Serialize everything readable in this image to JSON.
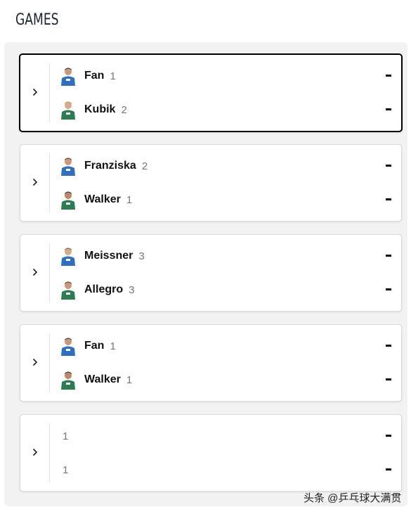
{
  "section_title": "GAMES",
  "colors": {
    "team_a": "#2f6fc2",
    "team_b": "#2d7d52",
    "selected_border": "#000000"
  },
  "games": [
    {
      "selected": true,
      "player1": {
        "name": "Fan",
        "games": "1",
        "team": "blue"
      },
      "player2": {
        "name": "Kubik",
        "games": "2",
        "team": "green"
      },
      "score1": "-",
      "score2": "-"
    },
    {
      "selected": false,
      "player1": {
        "name": "Franziska",
        "games": "2",
        "team": "blue"
      },
      "player2": {
        "name": "Walker",
        "games": "1",
        "team": "green"
      },
      "score1": "-",
      "score2": "-"
    },
    {
      "selected": false,
      "player1": {
        "name": "Meissner",
        "games": "3",
        "team": "blue"
      },
      "player2": {
        "name": "Allegro",
        "games": "3",
        "team": "green"
      },
      "score1": "-",
      "score2": "-"
    },
    {
      "selected": false,
      "player1": {
        "name": "Fan",
        "games": "1",
        "team": "blue"
      },
      "player2": {
        "name": "Walker",
        "games": "1",
        "team": "green"
      },
      "score1": "-",
      "score2": "-"
    },
    {
      "selected": false,
      "player1": {
        "name": "",
        "games": "1",
        "team": ""
      },
      "player2": {
        "name": "",
        "games": "1",
        "team": ""
      },
      "score1": "-",
      "score2": "-"
    }
  ],
  "watermark": "头条 @乒乓球大满贯"
}
